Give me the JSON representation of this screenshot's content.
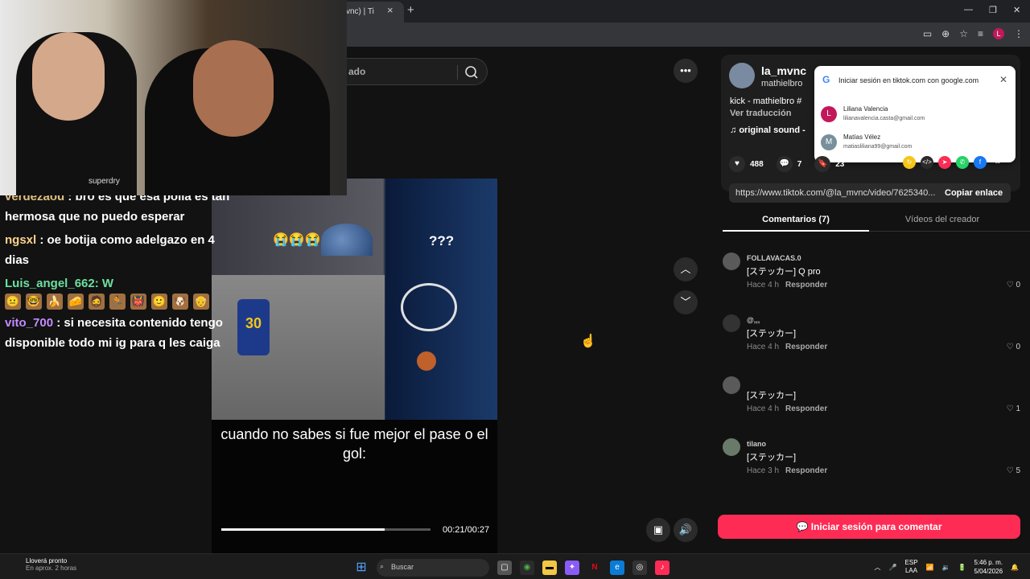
{
  "browser": {
    "tab_title": "vnc) | Ti",
    "close": "×",
    "new_tab": "+",
    "minimize": "—",
    "restore": "❐",
    "close_window": "✕",
    "profile_initial": "L"
  },
  "search": {
    "placeholder_fragment": "ado"
  },
  "video": {
    "question": "???",
    "emojis": "😭😭😭",
    "jersey_number": "30",
    "caption": "cuando no sabes si fue mejor el pase o el gol:",
    "time": "00:21/00:27",
    "progress": 0.78
  },
  "chat": [
    {
      "user": "verdezaou",
      "text": ": bro es que esa polla es tan hermosa que no puedo esperar"
    },
    {
      "user": "ngsxl",
      "text": ": oe botija como adelgazo en 4 dias"
    },
    {
      "user": "Luis_angel_662",
      "text": ": W"
    },
    {
      "user": "vito_700",
      "text": ": si necesita contenido tengo disponible todo mi ig para q les caiga"
    }
  ],
  "webcam": {
    "shirt_brand": "superdry"
  },
  "author": {
    "name": "la_mvnc",
    "sub": "mathielbro",
    "desc": "kick - mathielbro #",
    "translate": "Ver traducción",
    "sound": "original sound -"
  },
  "google_popup": {
    "title": "Iniciar sesión en tiktok.com con google.com",
    "accounts": [
      {
        "initial": "L",
        "name": "Liliana Valencia",
        "email": "lilianavalencia.casta@gmail.com",
        "color": "#c2185b"
      },
      {
        "initial": "M",
        "name": "Matías Vélez",
        "email": "matiasliliana99@gmail.com",
        "color": "#78909c"
      }
    ]
  },
  "stats": {
    "likes": "488",
    "comments": "7",
    "saves": "23"
  },
  "link": {
    "url": "https://www.tiktok.com/@la_mvnc/video/7625340...",
    "copy": "Copiar enlace"
  },
  "tabs": {
    "comments": "Comentarios (7)",
    "creator": "Vídeos del creador"
  },
  "comments": [
    {
      "user": "FOLLAVACAS.0",
      "text": "[ステッカー] Q pro",
      "time": "Hace 4 h",
      "reply": "Responder",
      "likes": "0"
    },
    {
      "user": "@,,,",
      "text": "[ステッカー]",
      "time": "Hace 4 h",
      "reply": "Responder",
      "likes": "0"
    },
    {
      "user": "",
      "text": "[ステッカー]",
      "time": "Hace 4 h",
      "reply": "Responder",
      "likes": "1"
    },
    {
      "user": "tilano",
      "text": "[ステッカー]",
      "time": "Hace 3 h",
      "reply": "Responder",
      "likes": "5"
    }
  ],
  "login": "Iniciar sesión para comentar",
  "taskbar": {
    "weather_title": "Lloverá pronto",
    "weather_sub": "En aprox. 2 horas",
    "search": "Buscar",
    "lang1": "ESP",
    "lang2": "LAA",
    "time": "5:46 p. m.",
    "date": "5/04/2026"
  },
  "colors": {
    "accent": "#fe2c55",
    "panel": "#121212"
  }
}
